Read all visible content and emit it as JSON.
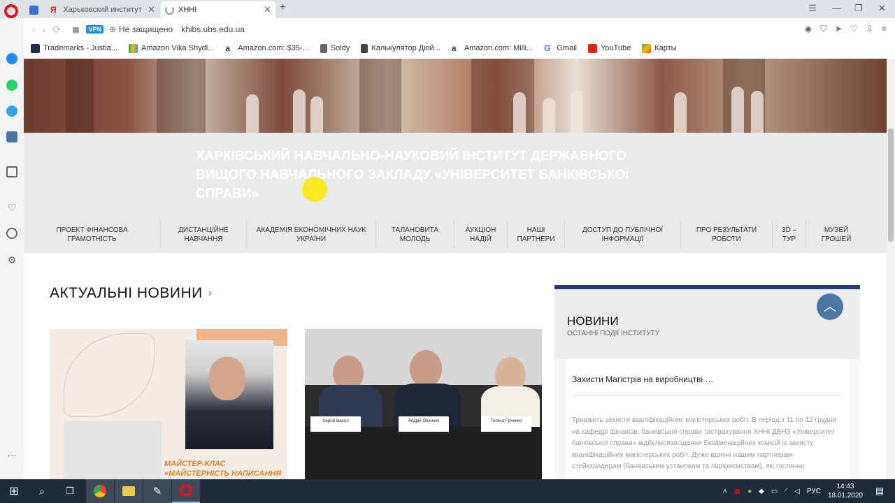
{
  "browser": {
    "tabs": [
      {
        "label": "Харьковский институт бан"
      },
      {
        "label": "ХННІ"
      }
    ],
    "address": {
      "vpn": "VPN",
      "security": "Не защищено",
      "url": "khibs.ubs.edu.ua"
    },
    "bookmarks": [
      {
        "label": "Trademarks - Justia..."
      },
      {
        "label": "Amazon Vika Shydl..."
      },
      {
        "label": "Amazon.com: $35-..."
      },
      {
        "label": "Soldy"
      },
      {
        "label": "Калькулятор Дюй..."
      },
      {
        "label": "Amazon.com: Milli..."
      },
      {
        "label": "Gmail"
      },
      {
        "label": "YouTube"
      },
      {
        "label": "Карты"
      }
    ]
  },
  "site": {
    "title": "ХАРКІВСЬКИЙ НАВЧАЛЬНО-НАУКОВИЙ ІНСТИТУТ ДЕРЖАВНОГО ВИЩОГО НАВЧАЛЬНОГО ЗАКЛАДУ «УНІВЕРСИТЕТ БАНКІВСЬКОЇ СПРАВИ»",
    "menu": [
      "ПРОЕКТ ФІНАНСОВА ГРАМОТНІСТЬ",
      "ДИСТАНЦІЙНЕ НАВЧАННЯ",
      "АКАДЕМІЯ ЕКОНОМІЧНИХ НАУК УКРАЇНИ",
      "ТАЛАНОВИТА МОЛОДЬ",
      "АУКЦІОН НАДІЙ",
      "НАШІ ПАРТНЕРИ",
      "ДОСТУП ДО ПУБЛІЧНОЇ ІНФОРМАЦІЇ",
      "ПРО РЕЗУЛЬТАТИ РОБОТИ",
      "3D – ТУР",
      "МУЗЕЙ ГРОШЕЙ"
    ],
    "news_heading": "АКТУАЛЬНІ НОВИНИ",
    "card1_caption": "МАЙСТЕР-КЛАС «МАЙСТЕРНІСТЬ НАПИСАННЯ",
    "card2_tags": [
      "Сергій Івасло",
      "Андрій Оленчик",
      "Тетяна Гірченко"
    ],
    "panel": {
      "title": "НОВИНИ",
      "subtitle": "ОСТАННІ ПОДІЇ ІНСТИТУТУ",
      "item_title": "Захисти Магістрів на виробництві …",
      "item_text": "Тривають захисти кваліфікаційних магістерських робіт. В період з 11 по 12 грудня на кафедрі фінансів, банківської справи тастрахування ХННІ ДВНЗ «Університет банківської справи» відбулисязасідання Екзаменаційних комісій із захисту кваліфікаційних магістерських робіт. Дуже вдячні нашим партнерам-стейкхолдерам (банківським установам та підприємствам), які гостинно"
    }
  },
  "taskbar": {
    "lang": "РУС",
    "time": "14:43",
    "date": "18.01.2020"
  },
  "colors": {
    "accent_navy": "#223d7c",
    "scroll_btn": "#4c77a5",
    "opera_red": "#e0141e",
    "taskbar": "#1d2b3a"
  }
}
